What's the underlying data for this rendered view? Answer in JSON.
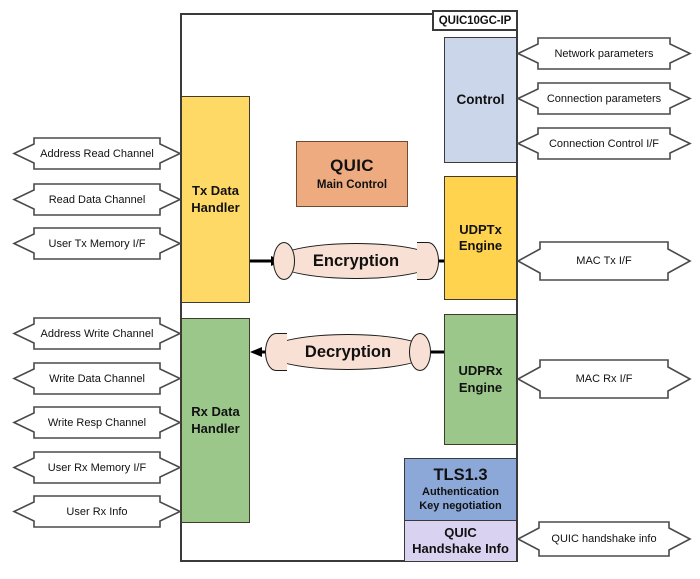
{
  "diagram": {
    "title": "QUIC10GC-IP",
    "ip_label": "QUIC10GC-IP"
  },
  "blocks": {
    "tx_data_handler": {
      "line1": "Tx Data",
      "line2": "Handler",
      "color": "#ffd966"
    },
    "rx_data_handler": {
      "line1": "Rx Data",
      "line2": "Handler",
      "color": "#9bc78a"
    },
    "quic_main_control": {
      "line1": "QUIC",
      "line2": "Main Control",
      "color": "#edab7f"
    },
    "control": {
      "line1": "Control",
      "line2": "",
      "color": "#ccd6ea"
    },
    "udptx_engine": {
      "line1": "UDPTx",
      "line2": "Engine",
      "color": "#ffd34d"
    },
    "udprx_engine": {
      "line1": "UDPRx",
      "line2": "Engine",
      "color": "#9bc78a"
    },
    "tls13": {
      "line1": "TLS1.3",
      "line2": "Authentication",
      "line3": "Key negotiation",
      "color": "#8ca8d8"
    },
    "quic_handshake_info": {
      "line1": "QUIC",
      "line2": "Handshake Info",
      "color": "#d9d2f0"
    },
    "encryption": {
      "label": "Encryption",
      "color": "#f9e0d4"
    },
    "decryption": {
      "label": "Decryption",
      "color": "#f9e0d4"
    }
  },
  "left_interfaces": [
    {
      "label": "Address Read Channel"
    },
    {
      "label": "Read Data Channel"
    },
    {
      "label": "User Tx Memory I/F"
    },
    {
      "label": "Address Write Channel"
    },
    {
      "label": "Write Data Channel"
    },
    {
      "label": "Write Resp Channel"
    },
    {
      "label": "User Rx Memory I/F"
    },
    {
      "label": "User Rx Info"
    }
  ],
  "right_interfaces": [
    {
      "label": "Network parameters"
    },
    {
      "label": "Connection parameters"
    },
    {
      "label": "Connection Control I/F"
    },
    {
      "label": "MAC Tx I/F"
    },
    {
      "label": "MAC Rx I/F"
    },
    {
      "label": "QUIC handshake info"
    }
  ],
  "colors": {
    "outline": "#3a3a3a",
    "arrow_stroke": "#4a4a4a",
    "text": "#111111"
  }
}
